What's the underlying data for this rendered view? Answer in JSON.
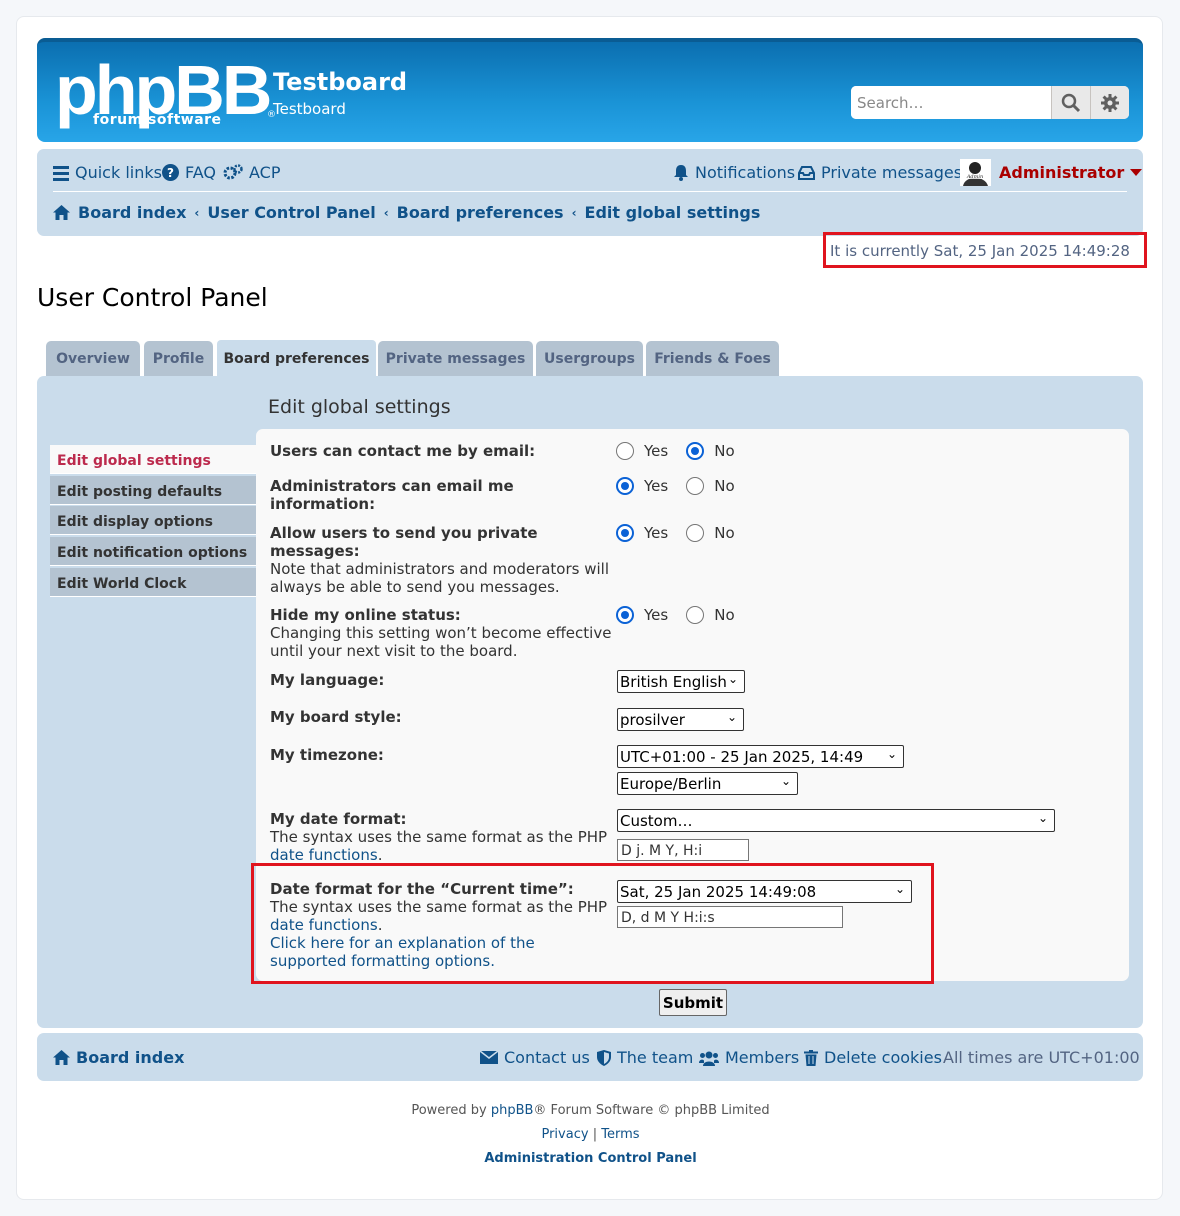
{
  "header": {
    "logo_main": "phpBB",
    "logo_sub": "forum software",
    "site_title": "Testboard",
    "site_desc": "Testboard",
    "search_placeholder": "Search…"
  },
  "navbar": {
    "quick_links": "Quick links",
    "faq": "FAQ",
    "acp": "ACP",
    "notifications": "Notifications",
    "private_messages": "Private messages",
    "username": "Administrator",
    "breadcrumbs": [
      "Board index",
      "User Control Panel",
      "Board preferences",
      "Edit global settings"
    ]
  },
  "current_time": "It is currently Sat, 25 Jan 2025 14:49:28",
  "page_title": "User Control Panel",
  "tabs": [
    "Overview",
    "Profile",
    "Board preferences",
    "Private messages",
    "Usergroups",
    "Friends & Foes"
  ],
  "section_title": "Edit global settings",
  "menu": [
    "Edit global settings",
    "Edit posting defaults",
    "Edit display options",
    "Edit notification options",
    "Edit World Clock"
  ],
  "form": {
    "yes": "Yes",
    "no": "No",
    "contact_email": {
      "label": "Users can contact me by email:",
      "value": "No"
    },
    "admin_email": {
      "label": "Administrators can email me information:",
      "value": "Yes"
    },
    "allow_pm": {
      "label": "Allow users to send you private messages:",
      "explain": "Note that administrators and moderators will always be able to send you messages.",
      "value": "Yes"
    },
    "hide_online": {
      "label": "Hide my online status:",
      "explain": "Changing this setting won’t become effective until your next visit to the board.",
      "value": "Yes"
    },
    "language": {
      "label": "My language:",
      "value": "British English"
    },
    "style": {
      "label": "My board style:",
      "value": "prosilver"
    },
    "timezone": {
      "label": "My timezone:",
      "value": "UTC+01:00 - 25 Jan 2025, 14:49",
      "zone": "Europe/Berlin"
    },
    "date_format": {
      "label": "My date format:",
      "explain": "The syntax uses the same format as the PHP",
      "link": "date functions",
      "select": "Custom…",
      "value": "D j. M Y, H:i"
    },
    "current_time_format": {
      "label": "Date format for the “Current time”:",
      "explain": "The syntax uses the same format as the PHP",
      "link": "date functions",
      "link2": "Click here for an explanation of the supported formatting options.",
      "select": "Sat, 25 Jan 2025 14:49:08",
      "value": "D, d M Y H:i:s"
    },
    "submit": "Submit"
  },
  "footer": {
    "board_index": "Board index",
    "contact_us": "Contact us",
    "the_team": "The team",
    "members": "Members",
    "delete_cookies": "Delete cookies",
    "all_times": "All times are UTC+01:00",
    "powered_pre": "Powered by",
    "powered_link": "phpBB",
    "powered_post": "® Forum Software © phpBB Limited",
    "privacy": "Privacy",
    "terms": "Terms",
    "acp": "Administration Control Panel"
  },
  "colors": {
    "accent": "#105289",
    "highlight": "#e0141e",
    "username": "#aa0000",
    "active_menu": "#bc2a4d"
  }
}
